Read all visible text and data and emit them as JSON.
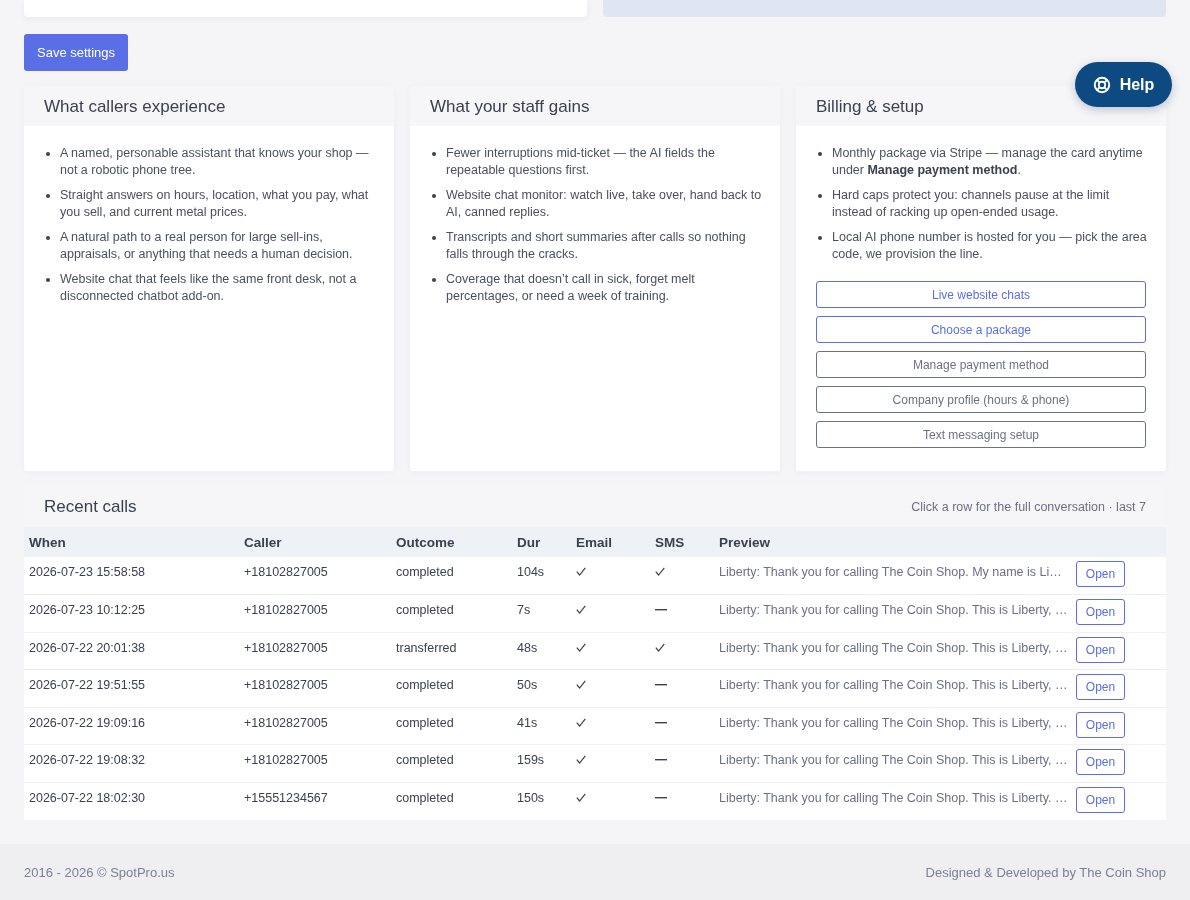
{
  "save_button": "Save settings",
  "help_button": "Help",
  "cards": [
    {
      "title": "What callers experience",
      "bullets": [
        "A named, personable assistant that knows your shop — not a robotic phone tree.",
        "Straight answers on hours, location, what you pay, what you sell, and current metal prices.",
        "A natural path to a real person for large sell-ins, appraisals, or anything that needs a human decision.",
        "Website chat that feels like the same front desk, not a disconnected chatbot add-on."
      ]
    },
    {
      "title": "What your staff gains",
      "bullets": [
        "Fewer interruptions mid-ticket — the AI fields the repeatable questions first.",
        "Website chat monitor: watch live, take over, hand back to AI, canned replies.",
        "Transcripts and short summaries after calls so nothing falls through the cracks.",
        "Coverage that doesn’t call in sick, forget melt percentages, or need a week of training."
      ]
    },
    {
      "title": "Billing & setup",
      "bullets": [
        "Monthly package via Stripe — manage the card anytime under **Manage payment method**.",
        "Hard caps protect you: channels pause at the limit instead of racking up open-ended usage.",
        "Local AI phone number is hosted for you — pick the area code, we provision the line."
      ],
      "buttons": [
        {
          "label": "Live website chats",
          "kind": "primary"
        },
        {
          "label": "Choose a package",
          "kind": "primary"
        },
        {
          "label": "Manage payment method",
          "kind": "secondary"
        },
        {
          "label": "Company profile (hours & phone)",
          "kind": "secondary"
        },
        {
          "label": "Text messaging setup",
          "kind": "secondary"
        }
      ]
    }
  ],
  "recent_calls": {
    "title": "Recent calls",
    "note": "Click a row for the full conversation · last 7",
    "columns": [
      "When",
      "Caller",
      "Outcome",
      "Dur",
      "Email",
      "SMS",
      "Preview"
    ],
    "rows": [
      {
        "when": "2026-07-23 15:58:58",
        "caller": "+18102827005",
        "outcome": "completed",
        "dur": "104s",
        "email": true,
        "sms": true,
        "preview": "Liberty: Thank you for calling The Coin Shop. My name is Li…",
        "action": "Open"
      },
      {
        "when": "2026-07-23 10:12:25",
        "caller": "+18102827005",
        "outcome": "completed",
        "dur": "7s",
        "email": true,
        "sms": false,
        "preview": "Liberty: Thank you for calling The Coin Shop. This is Liberty, …",
        "action": "Open"
      },
      {
        "when": "2026-07-22 20:01:38",
        "caller": "+18102827005",
        "outcome": "transferred",
        "dur": "48s",
        "email": true,
        "sms": true,
        "preview": "Liberty: Thank you for calling The Coin Shop. This is Liberty, …",
        "action": "Open"
      },
      {
        "when": "2026-07-22 19:51:55",
        "caller": "+18102827005",
        "outcome": "completed",
        "dur": "50s",
        "email": true,
        "sms": false,
        "preview": "Liberty: Thank you for calling The Coin Shop. This is Liberty, …",
        "action": "Open"
      },
      {
        "when": "2026-07-22 19:09:16",
        "caller": "+18102827005",
        "outcome": "completed",
        "dur": "41s",
        "email": true,
        "sms": false,
        "preview": "Liberty: Thank you for calling The Coin Shop. This is Liberty, …",
        "action": "Open"
      },
      {
        "when": "2026-07-22 19:08:32",
        "caller": "+18102827005",
        "outcome": "completed",
        "dur": "159s",
        "email": true,
        "sms": false,
        "preview": "Liberty: Thank you for calling The Coin Shop. This is Liberty, …",
        "action": "Open"
      },
      {
        "when": "2026-07-22 18:02:30",
        "caller": "+15551234567",
        "outcome": "completed",
        "dur": "150s",
        "email": true,
        "sms": false,
        "preview": "Liberty: Thank you for calling The Coin Shop. This is Liberty. …",
        "action": "Open"
      }
    ]
  },
  "footer": {
    "left": "2016 - 2026 © SpotPro.us",
    "right": "Designed & Developed by The Coin Shop"
  }
}
